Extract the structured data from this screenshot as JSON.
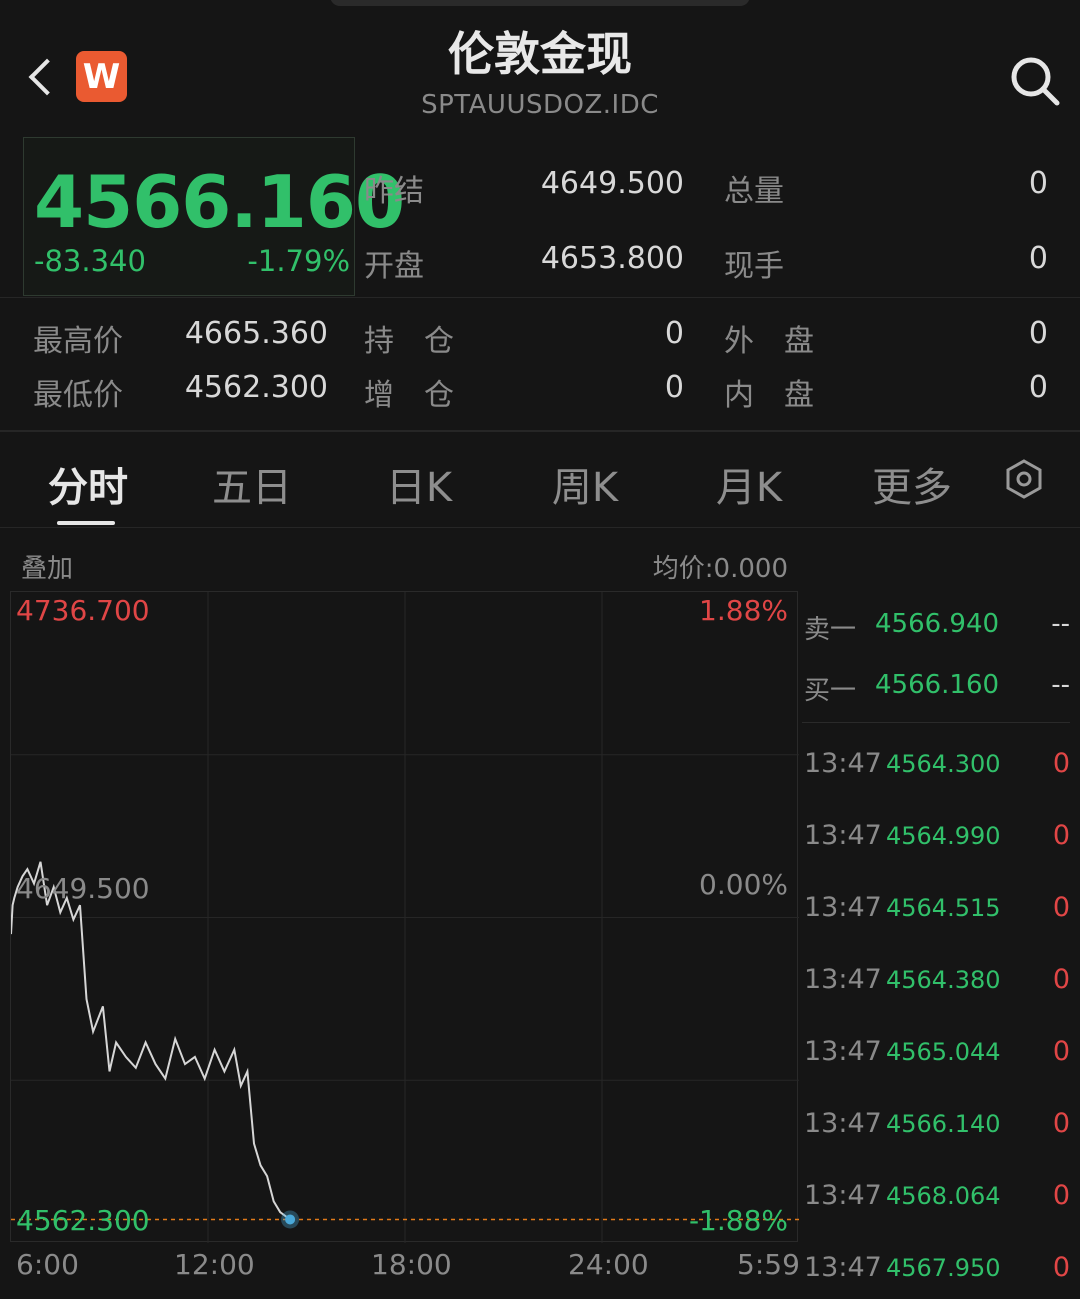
{
  "header": {
    "title": "伦敦金现",
    "subtitle": "SPTAUUSDOZ.IDC",
    "logo_text": "W"
  },
  "quote": {
    "last": "4566.160",
    "change": "-83.340",
    "change_pct": "-1.79%",
    "prev_settle_label": "昨结",
    "prev_settle": "4649.500",
    "open_label": "开盘",
    "open": "4653.800",
    "total_vol_label": "总量",
    "total_vol": "0",
    "cur_vol_label": "现手",
    "cur_vol": "0",
    "high_label": "最高价",
    "high": "4665.360",
    "low_label": "最低价",
    "low": "4562.300",
    "oi_label": "持　仓",
    "oi": "0",
    "oi_chg_label": "增　仓",
    "oi_chg": "0",
    "outer_label": "外　盘",
    "outer": "0",
    "inner_label": "内　盘",
    "inner": "0"
  },
  "tabs": [
    "分时",
    "五日",
    "日K",
    "周K",
    "月K",
    "更多"
  ],
  "overlay_label": "叠加",
  "avg_price_label": "均价:0.000",
  "orderbook": {
    "ask_label": "卖一",
    "ask_price": "4566.940",
    "ask_vol": "--",
    "bid_label": "买一",
    "bid_price": "4566.160",
    "bid_vol": "--"
  },
  "trades": [
    {
      "time": "13:47",
      "price": "4564.300",
      "vol": "0"
    },
    {
      "time": "13:47",
      "price": "4564.990",
      "vol": "0"
    },
    {
      "time": "13:47",
      "price": "4564.515",
      "vol": "0"
    },
    {
      "time": "13:47",
      "price": "4564.380",
      "vol": "0"
    },
    {
      "time": "13:47",
      "price": "4565.044",
      "vol": "0"
    },
    {
      "time": "13:47",
      "price": "4566.140",
      "vol": "0"
    },
    {
      "time": "13:47",
      "price": "4568.064",
      "vol": "0"
    },
    {
      "time": "13:47",
      "price": "4567.950",
      "vol": "0"
    }
  ],
  "chart_data": {
    "type": "line",
    "y_left_labels": [
      "4736.700",
      "4649.500",
      "4562.300"
    ],
    "y_right_labels": [
      "1.88%",
      "0.00%",
      "-1.88%"
    ],
    "x_tick_labels": [
      "6:00",
      "12:00",
      "18:00",
      "24:00",
      "5:59"
    ],
    "ylim": [
      4562.3,
      4736.7
    ],
    "reference": 4649.5,
    "series": [
      {
        "x": [
          0,
          0.05,
          0.1,
          0.2,
          0.35,
          0.5,
          0.7,
          0.9,
          1.1,
          1.3,
          1.5,
          1.7,
          1.9,
          2.1,
          2.3,
          2.5,
          2.8,
          3.0,
          3.2,
          3.5,
          3.8,
          4.1,
          4.4,
          4.7,
          5.0,
          5.3,
          5.6,
          5.9,
          6.2,
          6.5,
          6.8,
          7.0,
          7.2,
          7.4,
          7.6,
          7.8,
          8.0,
          8.2,
          8.5
        ],
        "values": [
          4642,
          4650,
          4652,
          4655,
          4658,
          4660,
          4656,
          4662,
          4650,
          4655,
          4648,
          4652,
          4646,
          4650,
          4624,
          4615,
          4622,
          4604,
          4612,
          4608,
          4605,
          4612,
          4606,
          4602,
          4613,
          4606,
          4608,
          4602,
          4610,
          4604,
          4610,
          4600,
          4604,
          4584,
          4578,
          4575,
          4568,
          4565,
          4563
        ]
      }
    ]
  },
  "colors": {
    "up": "#e04646",
    "down": "#31c06a",
    "line": "#d6d6d6",
    "dashed": "#e07a1a",
    "marker": "#4aa8d8"
  }
}
